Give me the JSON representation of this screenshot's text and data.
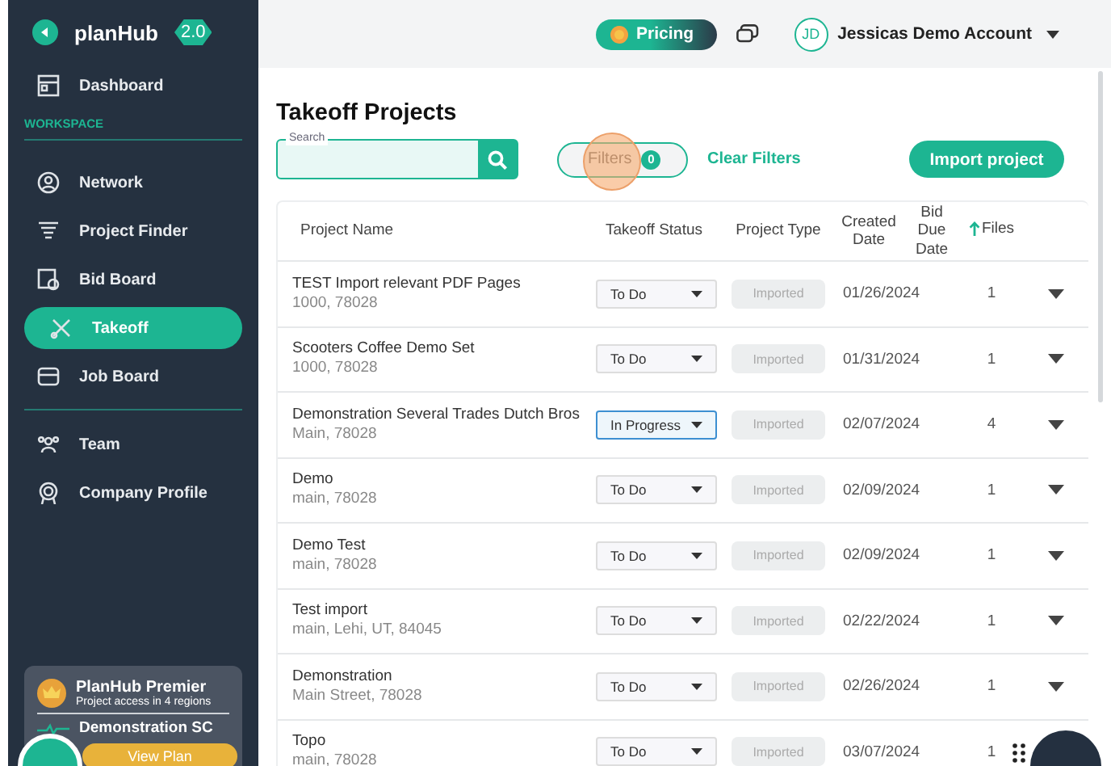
{
  "app": {
    "logo": "planHub",
    "version": "2.0"
  },
  "sidebar": {
    "top_items": [
      {
        "label": "Dashboard",
        "selected": false
      }
    ],
    "section": "WORKSPACE",
    "items": [
      {
        "label": "Network",
        "selected": false
      },
      {
        "label": "Project Finder",
        "selected": false
      },
      {
        "label": "Bid Board",
        "selected": false
      },
      {
        "label": "Takeoff",
        "selected": true
      },
      {
        "label": "Job Board",
        "selected": false
      }
    ],
    "more_items": [
      {
        "label": "Team",
        "selected": false
      },
      {
        "label": "Company Profile",
        "selected": false
      }
    ],
    "plan_card": {
      "title": "PlanHub Premier",
      "subtitle": "Project access in 4 regions",
      "company": "Demonstration SC",
      "button": "View Plan"
    }
  },
  "topbar": {
    "pricing": "Pricing",
    "avatar": "JD",
    "account": "Jessicas Demo Account"
  },
  "page": {
    "title": "Takeoff Projects",
    "search": {
      "label": "Search"
    },
    "filters": {
      "label": "Filters",
      "count": "0"
    },
    "clear_filters": "Clear Filters",
    "import_button": "Import project"
  },
  "table": {
    "columns": [
      {
        "label": "Project Name",
        "sorted": false
      },
      {
        "label": "Takeoff Status",
        "sorted": false
      },
      {
        "label": "Project Type",
        "sorted": false
      },
      {
        "label": "Created Date",
        "sorted": false
      },
      {
        "label": "Bid Due Date",
        "sorted": false
      },
      {
        "label": "Files",
        "sorted": true
      }
    ],
    "rows": [
      {
        "name": "TEST Import relevant PDF Pages",
        "address": "1000, 78028",
        "status": "To Do",
        "focused": false,
        "type": "Imported",
        "created": "01/26/2024",
        "files": "1"
      },
      {
        "name": "Scooters Coffee Demo Set",
        "address": "1000, 78028",
        "status": "To Do",
        "focused": false,
        "type": "Imported",
        "created": "01/31/2024",
        "files": "1"
      },
      {
        "name": "Demonstration Several Trades Dutch Bros",
        "address": "Main, 78028",
        "status": "In Progress",
        "focused": true,
        "type": "Imported",
        "created": "02/07/2024",
        "files": "4"
      },
      {
        "name": "Demo",
        "address": "main, 78028",
        "status": "To Do",
        "focused": false,
        "type": "Imported",
        "created": "02/09/2024",
        "files": "1"
      },
      {
        "name": "Demo Test",
        "address": "main, 78028",
        "status": "To Do",
        "focused": false,
        "type": "Imported",
        "created": "02/09/2024",
        "files": "1"
      },
      {
        "name": "Test import",
        "address": "main, Lehi, UT, 84045",
        "status": "To Do",
        "focused": false,
        "type": "Imported",
        "created": "02/22/2024",
        "files": "1"
      },
      {
        "name": "Demonstration",
        "address": "Main Street, 78028",
        "status": "To Do",
        "focused": false,
        "type": "Imported",
        "created": "02/26/2024",
        "files": "1"
      },
      {
        "name": "Topo",
        "address": "main, 78028",
        "status": "To Do",
        "focused": false,
        "type": "Imported",
        "created": "03/07/2024",
        "files": "1"
      }
    ]
  }
}
